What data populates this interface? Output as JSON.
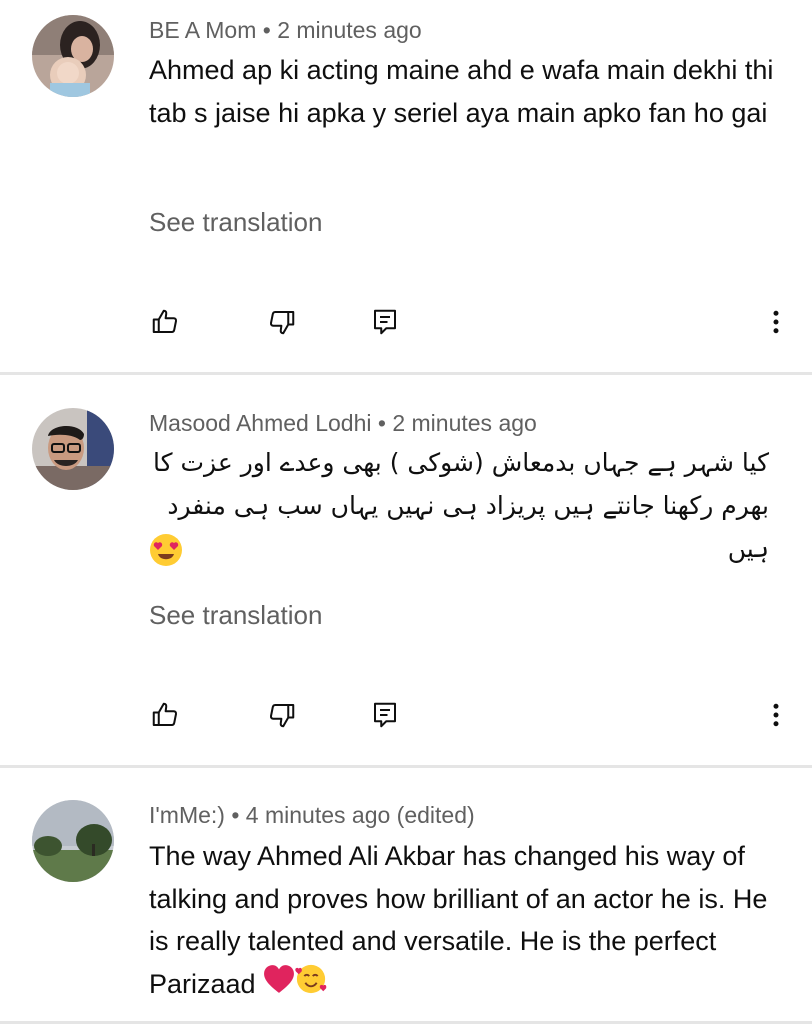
{
  "comments": [
    {
      "author": "BE A Mom",
      "time": "2 minutes ago",
      "text": "Ahmed ap ki acting maine ahd e wafa main dekhi thi tab s jaise hi apka y seriel aya main apko fan ho gai",
      "translate_label": "See translation"
    },
    {
      "author": "Masood Ahmed Lodhi",
      "time": "2 minutes ago",
      "text": "کیا شہر ہے جہاں بدمعاش (شوکی ) بھی وعدے اور عزت کا بھرم رکھنا جانتے ہیں پریزاد ہی نہیں یہاں سب ہی منفرد ہیں",
      "translate_label": "See translation"
    },
    {
      "author": "I'mMe:)",
      "time": "4 minutes ago (edited)",
      "text": "The way Ahmed Ali Akbar has changed his way of talking and proves how brilliant of an actor he is. He is really talented and versatile. He is the perfect Parizaad"
    }
  ],
  "separator": " • ",
  "icons": {
    "like": "thumbs-up-icon",
    "dislike": "thumbs-down-icon",
    "reply": "reply-comment-icon",
    "more": "more-vert-icon"
  },
  "colors": {
    "meta": "#606060",
    "text": "#0f0f0f",
    "divider": "#e5e5e5",
    "heart": "#e0245e"
  }
}
